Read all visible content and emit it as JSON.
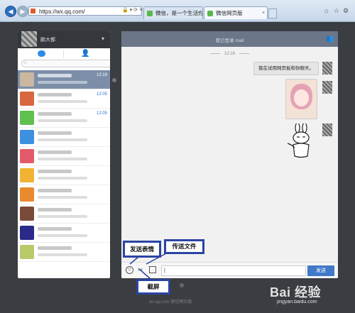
{
  "browser": {
    "address": "https://wx.qq.com/",
    "tabs": [
      {
        "label": "微信，是一个生活方式",
        "close": "×"
      },
      {
        "label": "微信网页版",
        "close": "×"
      }
    ]
  },
  "left_panel": {
    "username": "鹏大都",
    "conversations": [
      {
        "time": "12:19",
        "active": true,
        "color": "#c9b7a0"
      },
      {
        "time": "12:05",
        "active": false,
        "color": "#d8663e"
      },
      {
        "time": "12:05",
        "active": false,
        "color": "#5fbf4f"
      },
      {
        "time": "",
        "active": false,
        "color": "#3d8fe0"
      },
      {
        "time": "",
        "active": false,
        "color": "#e55a6a"
      },
      {
        "time": "",
        "active": false,
        "color": "#f2b233"
      },
      {
        "time": "",
        "active": false,
        "color": "#e98a2d"
      },
      {
        "time": "",
        "active": false,
        "color": "#7b4b3a"
      },
      {
        "time": "",
        "active": false,
        "color": "#2a2a8a"
      },
      {
        "time": "",
        "active": false,
        "color": "#b8c96a"
      }
    ]
  },
  "chat": {
    "title": "我已登录 mail",
    "time_separator": "12:18",
    "message": "我在试用网页板和你聊天。",
    "send_label": "发送"
  },
  "callouts": {
    "emoji": "发送表情",
    "file": "传送文件",
    "screenshot": "截屏"
  },
  "footer": "wx.qq.com 微信网页版",
  "watermark": {
    "logo": "Bai 经验",
    "sub": "jingyan.baidu.com"
  },
  "colors": {
    "accent": "#3f79c8",
    "callout_border": "#2b44a3",
    "header": "#6b7688"
  }
}
